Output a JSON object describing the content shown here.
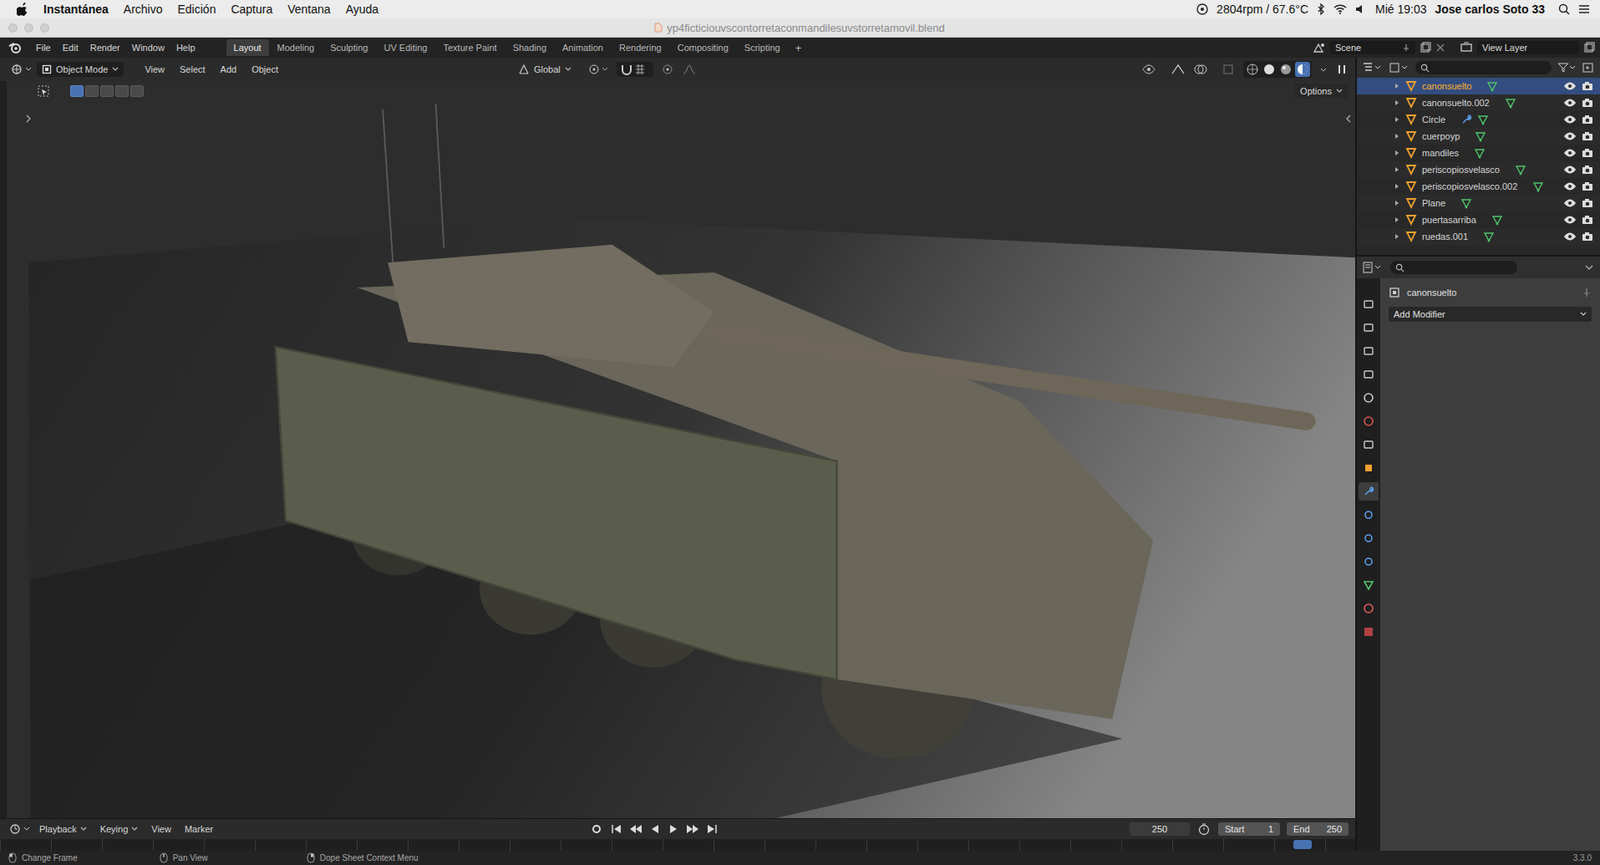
{
  "mac_menubar": {
    "app": "Instantánea",
    "menus": [
      "Archivo",
      "Edición",
      "Captura",
      "Ventana",
      "Ayuda"
    ],
    "status": {
      "fan": "2804rpm / 67.6°C",
      "clock": "Mié 19:03",
      "user": "Jose carlos Soto 33"
    }
  },
  "window": {
    "title": "yp4ficticiouvscontorretaconmandilesuvstorretamovil.blend"
  },
  "topbar": {
    "menus": [
      "File",
      "Edit",
      "Render",
      "Window",
      "Help"
    ],
    "workspaces": [
      {
        "label": "Layout",
        "selected": true
      },
      {
        "label": "Modeling",
        "selected": false
      },
      {
        "label": "Sculpting",
        "selected": false
      },
      {
        "label": "UV Editing",
        "selected": false
      },
      {
        "label": "Texture Paint",
        "selected": false
      },
      {
        "label": "Shading",
        "selected": false
      },
      {
        "label": "Animation",
        "selected": false
      },
      {
        "label": "Rendering",
        "selected": false
      },
      {
        "label": "Compositing",
        "selected": false
      },
      {
        "label": "Scripting",
        "selected": false
      }
    ],
    "add_tab": "+",
    "scene": "Scene",
    "view_layer": "View Layer"
  },
  "viewport_header": {
    "mode": "Object Mode",
    "menus": [
      "View",
      "Select",
      "Add",
      "Object"
    ],
    "orientation": "Global",
    "options": "Options"
  },
  "outliner": {
    "items": [
      {
        "name": "canonsuelto",
        "selected": true,
        "has_modifier": false,
        "visible": true,
        "renderable": true
      },
      {
        "name": "canonsuelto.002",
        "selected": false,
        "has_modifier": false,
        "visible": true,
        "renderable": true
      },
      {
        "name": "Circle",
        "selected": false,
        "has_modifier": true,
        "visible": true,
        "renderable": true
      },
      {
        "name": "cuerpoyp",
        "selected": false,
        "has_modifier": false,
        "visible": true,
        "renderable": true
      },
      {
        "name": "mandiles",
        "selected": false,
        "has_modifier": false,
        "visible": true,
        "renderable": true
      },
      {
        "name": "periscopiosvelasco",
        "selected": false,
        "has_modifier": false,
        "visible": true,
        "renderable": true
      },
      {
        "name": "periscopiosvelasco.002",
        "selected": false,
        "has_modifier": false,
        "visible": true,
        "renderable": true
      },
      {
        "name": "Plane",
        "selected": false,
        "has_modifier": false,
        "visible": true,
        "renderable": true
      },
      {
        "name": "puertasarriba",
        "selected": false,
        "has_modifier": false,
        "visible": true,
        "renderable": true
      },
      {
        "name": "ruedas.001",
        "selected": false,
        "has_modifier": false,
        "visible": true,
        "renderable": true
      }
    ]
  },
  "properties": {
    "object": "canonsuelto",
    "add_modifier": "Add Modifier",
    "tabs": [
      {
        "kind": "tool",
        "selected": false
      },
      {
        "kind": "render",
        "selected": false
      },
      {
        "kind": "output",
        "selected": false
      },
      {
        "kind": "view",
        "selected": false
      },
      {
        "kind": "scene",
        "selected": false
      },
      {
        "kind": "world",
        "selected": false
      },
      {
        "kind": "collection",
        "selected": false
      },
      {
        "kind": "object",
        "selected": false
      },
      {
        "kind": "modifiers",
        "selected": true
      },
      {
        "kind": "particles",
        "selected": false
      },
      {
        "kind": "physics",
        "selected": false
      },
      {
        "kind": "constraints",
        "selected": false
      },
      {
        "kind": "data",
        "selected": false
      },
      {
        "kind": "material",
        "selected": false
      },
      {
        "kind": "texture",
        "selected": false
      }
    ]
  },
  "timeline": {
    "menus": [
      "Playback",
      "Keying",
      "View",
      "Marker"
    ],
    "current_frame": "250",
    "start_label": "Start",
    "start": "1",
    "end_label": "End",
    "end": "250"
  },
  "status_bar": {
    "items": [
      "Change Frame",
      "Pan View",
      "Dope Sheet Context Menu"
    ],
    "version": "3.3.0"
  }
}
